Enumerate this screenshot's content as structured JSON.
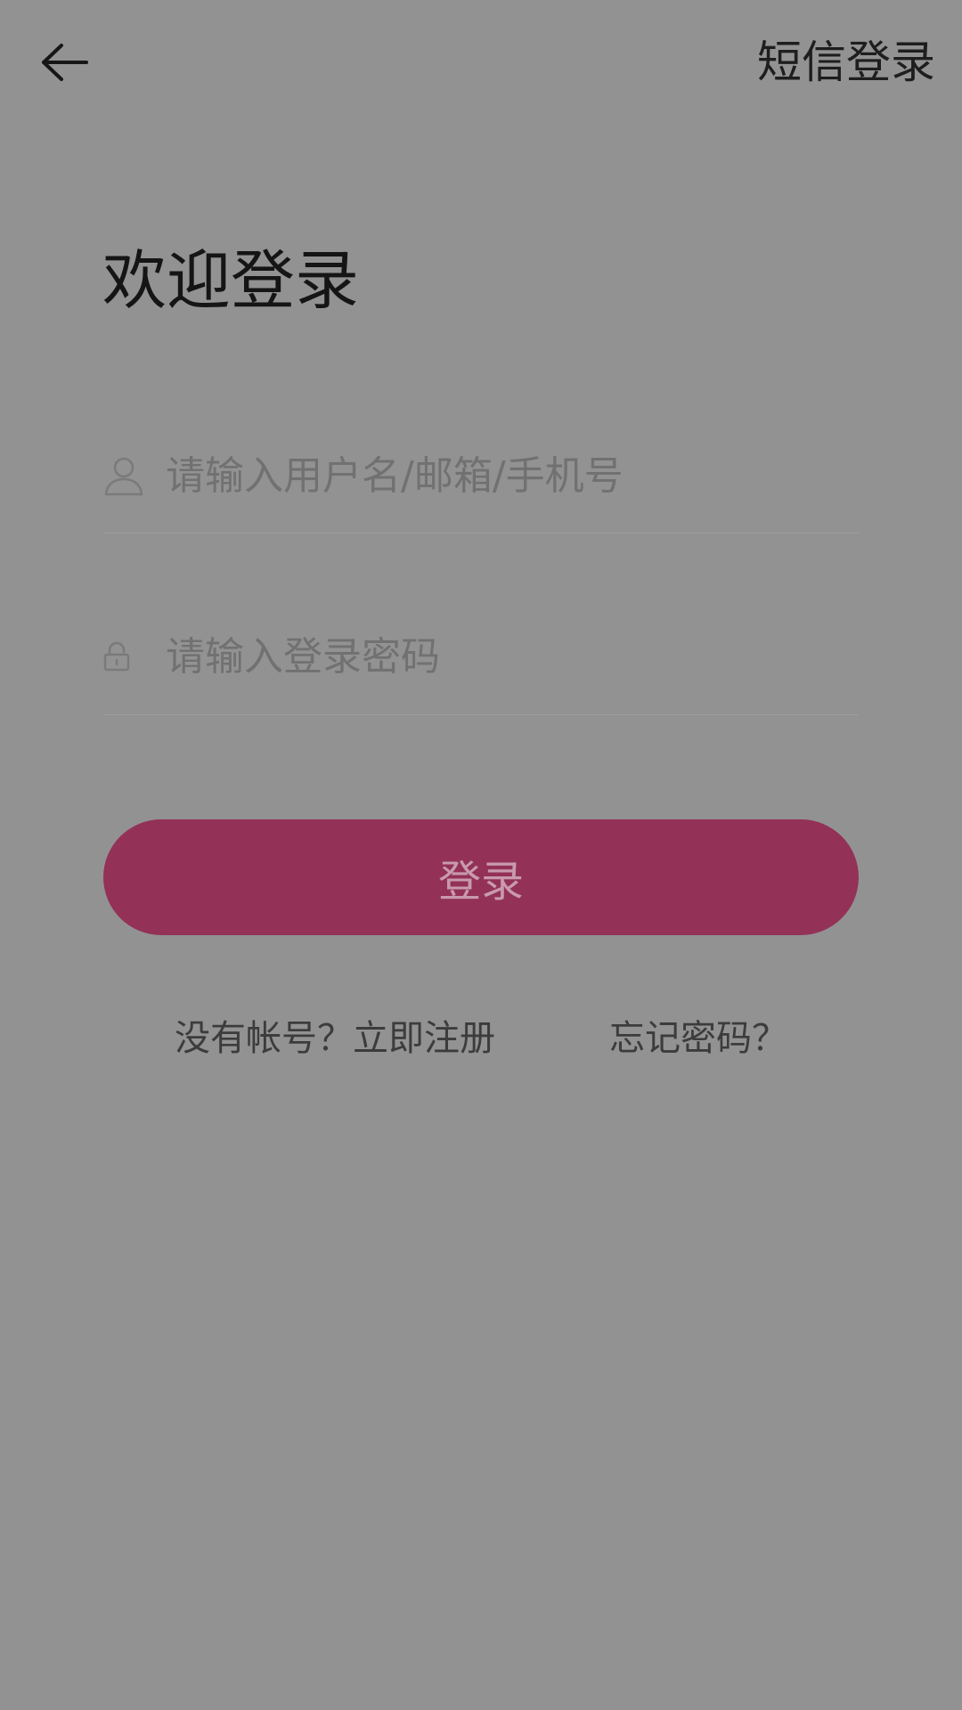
{
  "header": {
    "back_icon": "arrow-left-icon",
    "sms_login_label": "短信登录"
  },
  "title": "欢迎登录",
  "username_field": {
    "icon": "user-icon",
    "placeholder": "请输入用户名/邮箱/手机号",
    "value": ""
  },
  "password_field": {
    "icon": "lock-icon",
    "placeholder": "请输入登录密码",
    "value": ""
  },
  "login_button": {
    "label": "登录",
    "color": "#933157"
  },
  "links": {
    "register": "没有帐号？立即注册",
    "forgot": "忘记密码？"
  },
  "colors": {
    "background": "#929292",
    "accent": "#933157"
  }
}
